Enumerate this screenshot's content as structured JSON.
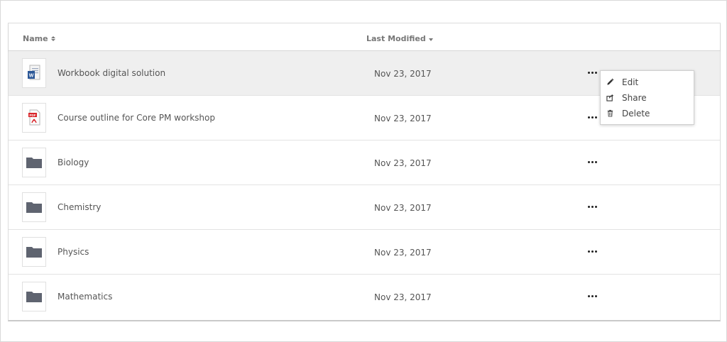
{
  "header": {
    "name_label": "Name",
    "modified_label": "Last Modified"
  },
  "rows": [
    {
      "name": "Workbook digital solution",
      "date": "Nov 23, 2017",
      "icon": "word-document-icon"
    },
    {
      "name": "Course outline for Core PM workshop",
      "date": "Nov 23, 2017",
      "icon": "pdf-document-icon"
    },
    {
      "name": "Biology",
      "date": "Nov 23, 2017",
      "icon": "folder-icon"
    },
    {
      "name": "Chemistry",
      "date": "Nov 23, 2017",
      "icon": "folder-icon"
    },
    {
      "name": "Physics",
      "date": "Nov 23, 2017",
      "icon": "folder-icon"
    },
    {
      "name": "Mathematics",
      "date": "Nov 23, 2017",
      "icon": "folder-icon"
    }
  ],
  "context_menu": {
    "items": [
      {
        "label": "Edit",
        "icon": "pencil-icon"
      },
      {
        "label": "Share",
        "icon": "share-icon"
      },
      {
        "label": "Delete",
        "icon": "trash-icon"
      }
    ]
  },
  "colors": {
    "active_row": "#efefef",
    "folder": "#5f6470",
    "pdf_red": "#d9252a",
    "word_blue": "#2b5797"
  }
}
